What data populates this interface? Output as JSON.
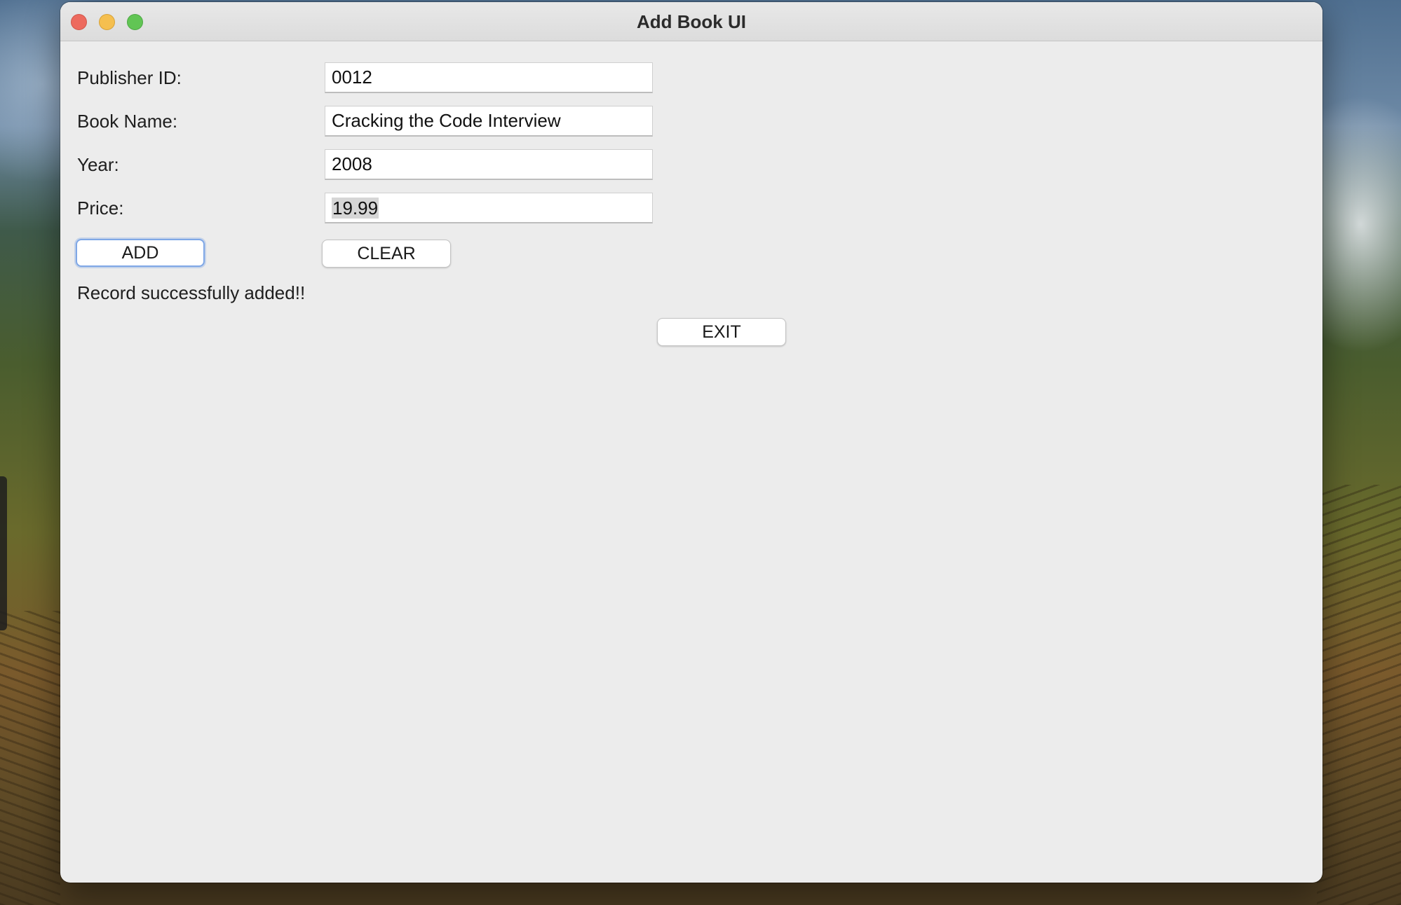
{
  "window": {
    "title": "Add Book UI"
  },
  "form": {
    "publisher_id": {
      "label": "Publisher ID:",
      "value": "0012"
    },
    "book_name": {
      "label": "Book Name:",
      "value": "Cracking the Code Interview"
    },
    "year": {
      "label": "Year:",
      "value": "2008"
    },
    "price": {
      "label": "Price:",
      "value": "19.99",
      "selected": true
    }
  },
  "buttons": {
    "add": "ADD",
    "clear": "CLEAR",
    "exit": "EXIT"
  },
  "status": {
    "message": "Record successfully added!!"
  },
  "colors": {
    "window_bg": "#ececec",
    "focus_ring": "#7fa7e6",
    "close": "#ed6a5e",
    "minimize": "#f5bf4f",
    "maximize": "#61c554"
  }
}
